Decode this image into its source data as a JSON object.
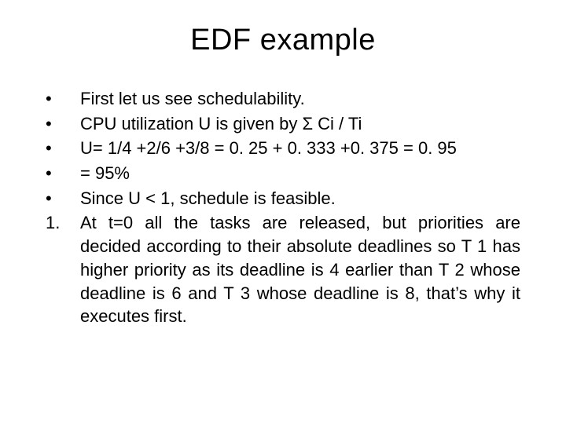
{
  "title": "EDF example",
  "items": [
    {
      "marker": "•",
      "text": "First let us see schedulability.",
      "justify": false
    },
    {
      "marker": "•",
      "text": "CPU utilization U is given by Σ Ci / Ti",
      "justify": false
    },
    {
      "marker": "•",
      "text": "U= 1/4 +2/6 +3/8 = 0. 25 + 0. 333 +0. 375 = 0. 95",
      "justify": false
    },
    {
      "marker": "•",
      "text": "= 95%",
      "justify": false
    },
    {
      "marker": "•",
      "text": "Since U < 1, schedule is feasible.",
      "justify": false
    },
    {
      "marker": "1.",
      "text": "At t=0 all the tasks are released, but priorities are decided according to their absolute deadlines so T 1 has higher priority as its deadline is 4 earlier than T 2 whose deadline is 6 and T 3 whose deadline is 8, that’s why it executes first.",
      "justify": true
    }
  ]
}
